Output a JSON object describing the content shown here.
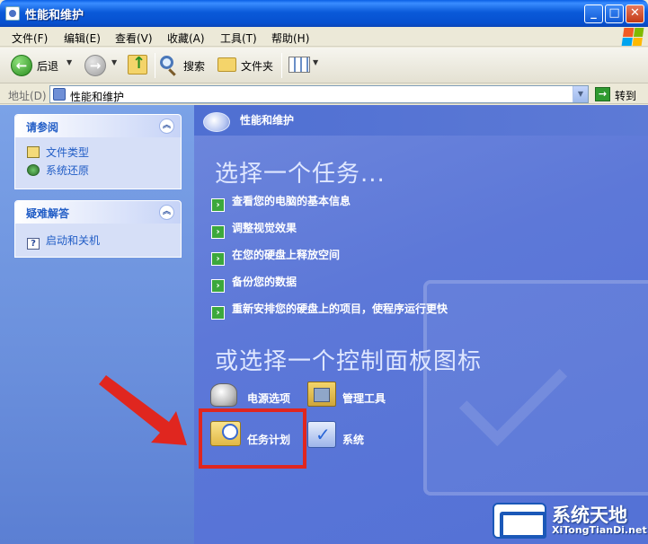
{
  "window": {
    "title": "性能和维护",
    "controls": {
      "minimize": "_",
      "maximize": "□",
      "close": "✕"
    }
  },
  "menu": {
    "items": [
      "文件(F)",
      "编辑(E)",
      "查看(V)",
      "收藏(A)",
      "工具(T)",
      "帮助(H)"
    ]
  },
  "toolbar": {
    "back_label": "后退",
    "search_label": "搜索",
    "folders_label": "文件夹"
  },
  "address": {
    "label": "地址(D)",
    "value": "性能和维护",
    "go_label": "转到"
  },
  "sidebar": {
    "panels": [
      {
        "title": "请参阅",
        "links": [
          "文件类型",
          "系统还原"
        ]
      },
      {
        "title": "疑难解答",
        "links": [
          "启动和关机"
        ]
      }
    ]
  },
  "main": {
    "header_title": "性能和维护",
    "task_heading": "选择一个任务...",
    "tasks": [
      "查看您的电脑的基本信息",
      "调整视觉效果",
      "在您的硬盘上释放空间",
      "备份您的数据",
      "重新安排您的硬盘上的项目，使程序运行更快"
    ],
    "icon_heading": "或选择一个控制面板图标",
    "icons": [
      "电源选项",
      "管理工具",
      "任务计划",
      "系统"
    ]
  },
  "watermark": {
    "title": "系统天地",
    "subtitle": "XiTongTianDi.net"
  },
  "colors": {
    "highlight": "#e0261f",
    "sidebar_link": "#215dc6",
    "main_bg": "#5d78d8"
  }
}
